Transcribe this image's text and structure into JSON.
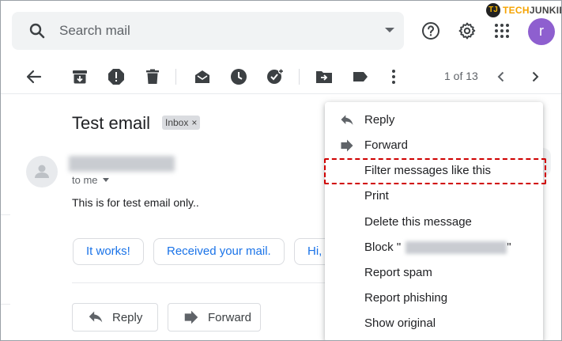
{
  "logo": {
    "mark": "TJ",
    "tech": "TECH",
    "junkie": "JUNKIE"
  },
  "search": {
    "placeholder": "Search mail"
  },
  "topbar": {
    "help_icon": "help-circle-icon",
    "settings_icon": "gear-icon",
    "apps_icon": "apps-grid-icon",
    "avatar_letter": "r",
    "avatar_color": "#8e5fcf"
  },
  "toolbar": {
    "pagination": "1 of 13"
  },
  "email": {
    "subject": "Test email",
    "label": "Inbox",
    "label_close": "×",
    "to": "to me",
    "body": "This is for test email only.."
  },
  "smart_replies": [
    "It works!",
    "Received your mail.",
    "Hi,"
  ],
  "actions": {
    "reply": "Reply",
    "forward": "Forward"
  },
  "menu": {
    "items": [
      {
        "label": "Reply",
        "icon": "reply-icon"
      },
      {
        "label": "Forward",
        "icon": "forward-icon"
      },
      {
        "label": "Filter messages like this"
      },
      {
        "label": "Print"
      },
      {
        "label": "Delete this message"
      },
      {
        "label": "Block"
      },
      {
        "label": "Report spam"
      },
      {
        "label": "Report phishing"
      },
      {
        "label": "Show original"
      }
    ],
    "block_quote_open": "\"",
    "block_quote_close": "\""
  },
  "colors": {
    "accent": "#1a73e8",
    "highlight": "#d00000"
  }
}
